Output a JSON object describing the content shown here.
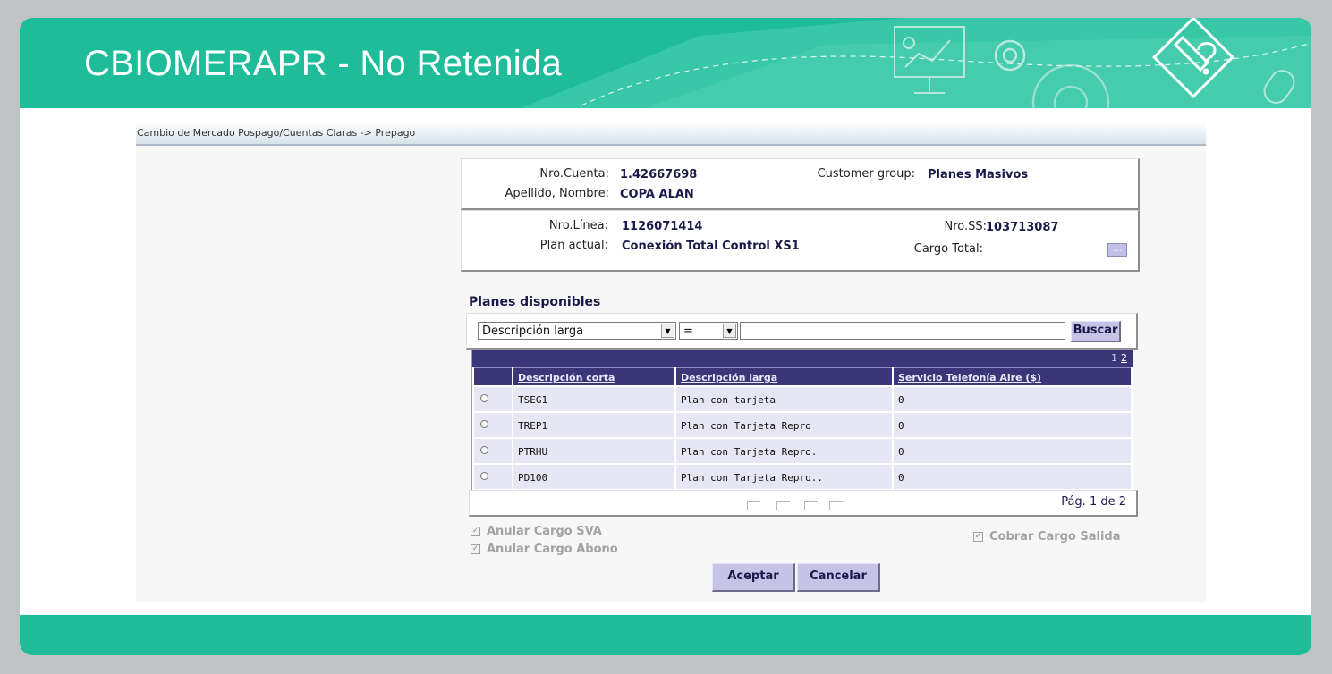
{
  "slide": {
    "title": "CBIOMERAPR - No Retenida",
    "colors": {
      "accent": "#1ebc99",
      "background": "#bfc3c4"
    },
    "deco_icons": [
      "presentation-icon",
      "gear-icon",
      "mouse-icon",
      "edit-diamond-icon"
    ]
  },
  "app": {
    "breadcrumb": "Cambio de Mercado Pospago/Cuentas Claras -> Prepago",
    "account": {
      "nro_cuenta_label": "Nro.Cuenta:",
      "nro_cuenta_value": "1.42667698",
      "apellido_label": "Apellido, Nombre:",
      "apellido_value": "COPA ALAN",
      "customer_group_label": "Customer group:",
      "customer_group_value": "Planes Masivos"
    },
    "line": {
      "nro_linea_label": "Nro.Línea:",
      "nro_linea_value": "1126071414",
      "plan_label": "Plan actual:",
      "plan_value": "Conexión Total Control XS1",
      "nro_ss_label": "Nro.SS:",
      "nro_ss_value": "103713087",
      "cargo_label": "Cargo Total:",
      "cargo_button": "..."
    },
    "planes": {
      "title": "Planes disponibles",
      "filter_field": "Descripción larga",
      "filter_operator": "=",
      "filter_value": "",
      "search_button": "Buscar",
      "pager_current": "1",
      "pager_next": "2",
      "columns": [
        "Descripción corta",
        "Descripción larga",
        "Servicio Telefonía Aire ($)"
      ],
      "rows": [
        {
          "corta": "TSEG1",
          "larga": "Plan con tarjeta",
          "aire": "0"
        },
        {
          "corta": "TREP1",
          "larga": "Plan con Tarjeta Repro",
          "aire": "0"
        },
        {
          "corta": "PTRHU",
          "larga": "Plan con Tarjeta Repro.",
          "aire": "0"
        },
        {
          "corta": "PD100",
          "larga": "Plan con Tarjeta Repro..",
          "aire": "0"
        }
      ],
      "page_info": "Pág. 1 de 2"
    },
    "options": {
      "anular_sva": "Anular Cargo SVA",
      "anular_abono": "Anular Cargo Abono",
      "cobrar_salida": "Cobrar Cargo Salida",
      "check_mark": "✓"
    },
    "buttons": {
      "accept": "Aceptar",
      "cancel": "Cancelar"
    }
  }
}
